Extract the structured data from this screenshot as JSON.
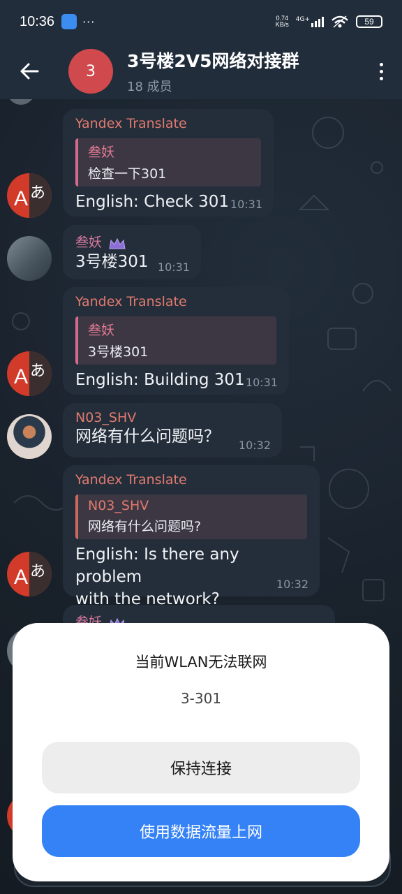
{
  "status_bar": {
    "time": "10:36",
    "dots": "···",
    "net_speed_top": "0.74",
    "net_speed_bottom": "KB/s",
    "net_type": "4G+",
    "battery": "59"
  },
  "header": {
    "avatar_letter": "3",
    "title": "3号楼2V5网络对接群",
    "subtitle": "18 成员"
  },
  "messages": [
    {
      "sender": "Yandex Translate",
      "quote_name": "叁妖",
      "quote_text": "检查一下301",
      "text": "English: Check 301",
      "time": "10:31"
    },
    {
      "sender": "叁妖",
      "text": "3号楼301",
      "time": "10:31"
    },
    {
      "sender": "Yandex Translate",
      "quote_name": "叁妖",
      "quote_text": "3号楼301",
      "text": "English: Building 301",
      "time": "10:31"
    },
    {
      "sender": "N03_SHV",
      "text": "网络有什么问题吗？",
      "time": "10:32"
    },
    {
      "sender": "Yandex Translate",
      "quote_name": "N03_SHV",
      "quote_text": "网络有什么问题吗?",
      "text_line1": "English: Is there any problem",
      "text_line2": "with the network?",
      "time": "10:32"
    },
    {
      "sender": "叁妖"
    }
  ],
  "translate_avatar": {
    "latin": "A",
    "kana": "あ"
  },
  "dialog": {
    "title": "当前WLAN无法联网",
    "network": "3-301",
    "keep_label": "保持连接",
    "mobile_label": "使用数据流量上网"
  },
  "colors": {
    "header_bg": "#212d3b",
    "bubble_bg": "#242e3b",
    "sender_orange": "#e07a6e",
    "sender_pink": "#d4789c",
    "primary_button": "#3482f6"
  }
}
